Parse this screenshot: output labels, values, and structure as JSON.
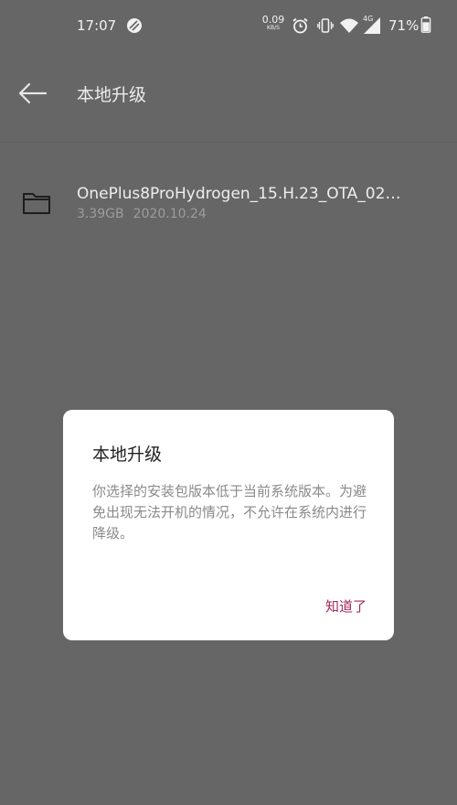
{
  "status_bar": {
    "time": "17:07",
    "net_speed_value": "0.09",
    "net_speed_unit": "KB/S",
    "network_label": "4G",
    "battery_percent": "71%",
    "icons": [
      "no-disturb-icon",
      "alarm-icon",
      "vibrate-icon",
      "wifi-icon",
      "signal-icon",
      "battery-icon"
    ]
  },
  "header": {
    "title": "本地升级",
    "back_icon": "back-arrow-icon"
  },
  "files": [
    {
      "name": "OnePlus8ProHydrogen_15.H.23_OTA_02…",
      "size": "3.39GB",
      "date": "2020.10.24",
      "icon": "folder-icon"
    }
  ],
  "dialog": {
    "title": "本地升级",
    "message": "你选择的安装包版本低于当前系统版本。为避免出现无法开机的情况，不允许在系统内进行降级。",
    "confirm_label": "知道了",
    "accent_color": "#a4275c"
  },
  "colors": {
    "overlay_background": "#666666",
    "dialog_background": "#ffffff"
  }
}
